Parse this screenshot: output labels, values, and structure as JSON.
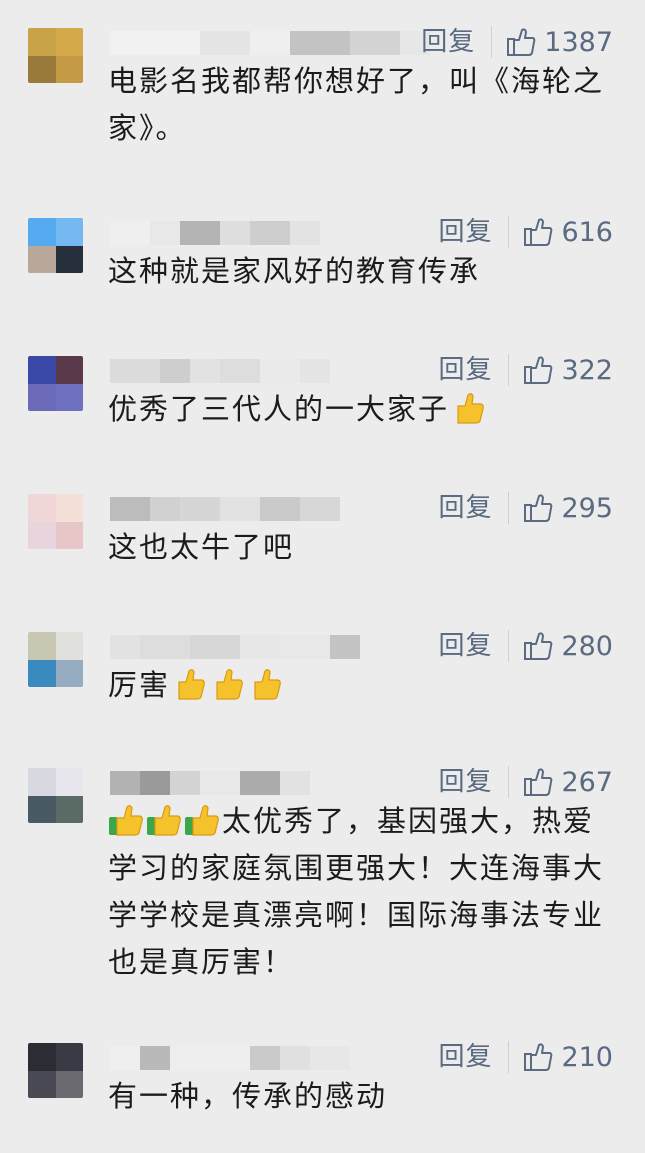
{
  "reply_label": "回复",
  "comments": [
    {
      "likes": "1387",
      "avatar_colors": [
        "#c9a348",
        "#d4a94a",
        "#9a7a3a",
        "#c59a45"
      ],
      "name_blocks": [
        "#f2f2f2",
        "#e4e4e4",
        "#f0f0f0",
        "#bcbcbc",
        "#cfcfcf",
        "#e6e6e6"
      ],
      "text": "电影名我都帮你想好了，叫《海轮之家》。"
    },
    {
      "likes": "616",
      "avatar_colors": [
        "#56aaf0",
        "#74b8f2",
        "#b9a79a",
        "#26303c"
      ],
      "name_blocks": [
        "#f0f0f0",
        "#e8e8e8",
        "#aaaaaa",
        "#dcdcdc",
        "#c9c9c9",
        "#e2e2e2"
      ],
      "text": "这种就是家风好的教育传承"
    },
    {
      "likes": "322",
      "avatar_colors": [
        "#3a48a8",
        "#5a3a4a",
        "#6a6ab8",
        "#7070c0"
      ],
      "name_blocks": [
        "#d8d8d8",
        "#c9c9c9",
        "#e0e0e0",
        "#dadada",
        "#eaeaea",
        "#e4e4e4"
      ],
      "text": "优秀了三代人的一大家子"
    },
    {
      "likes": "295",
      "avatar_colors": [
        "#f0d6d6",
        "#f4e0d8",
        "#e8d4dc",
        "#e6c6c6"
      ],
      "name_blocks": [
        "#b4b4b4",
        "#cccccc",
        "#d2d2d2",
        "#e0e0e0",
        "#c4c4c4",
        "#d4d4d4"
      ],
      "text": "这也太牛了吧"
    },
    {
      "likes": "280",
      "avatar_colors": [
        "#c8c8b2",
        "#e0e0dc",
        "#3a8ac0",
        "#96acc0"
      ],
      "name_blocks": [
        "#e0e0e0",
        "#dadada",
        "#d4d4d4",
        "#e6e6e6",
        "#e8e8e8",
        "#bdbdbd"
      ],
      "text": "厉害"
    },
    {
      "likes": "267",
      "avatar_colors": [
        "#d8d8e0",
        "#e6e6ec",
        "#4a5a64",
        "#5a6a64"
      ],
      "name_blocks": [
        "#a8a8a8",
        "#8c8c8c",
        "#cfcfcf",
        "#e8e8e8",
        "#a0a0a0",
        "#e0e0e0"
      ],
      "text": "太优秀了，基因强大，热爱学习的家庭氛围更强大！大连海事大学学校是真漂亮啊！国际海事法专业也是真厉害！"
    },
    {
      "likes": "210",
      "avatar_colors": [
        "#2c2c34",
        "#3a3a44",
        "#4a4a54",
        "#6a6a70"
      ],
      "name_blocks": [
        "#f0f0f0",
        "#b0b0b0",
        "#eeeeee",
        "#c4c4c4",
        "#dedede",
        "#e6e6e6"
      ],
      "text": "有一种，传承的感动"
    }
  ]
}
